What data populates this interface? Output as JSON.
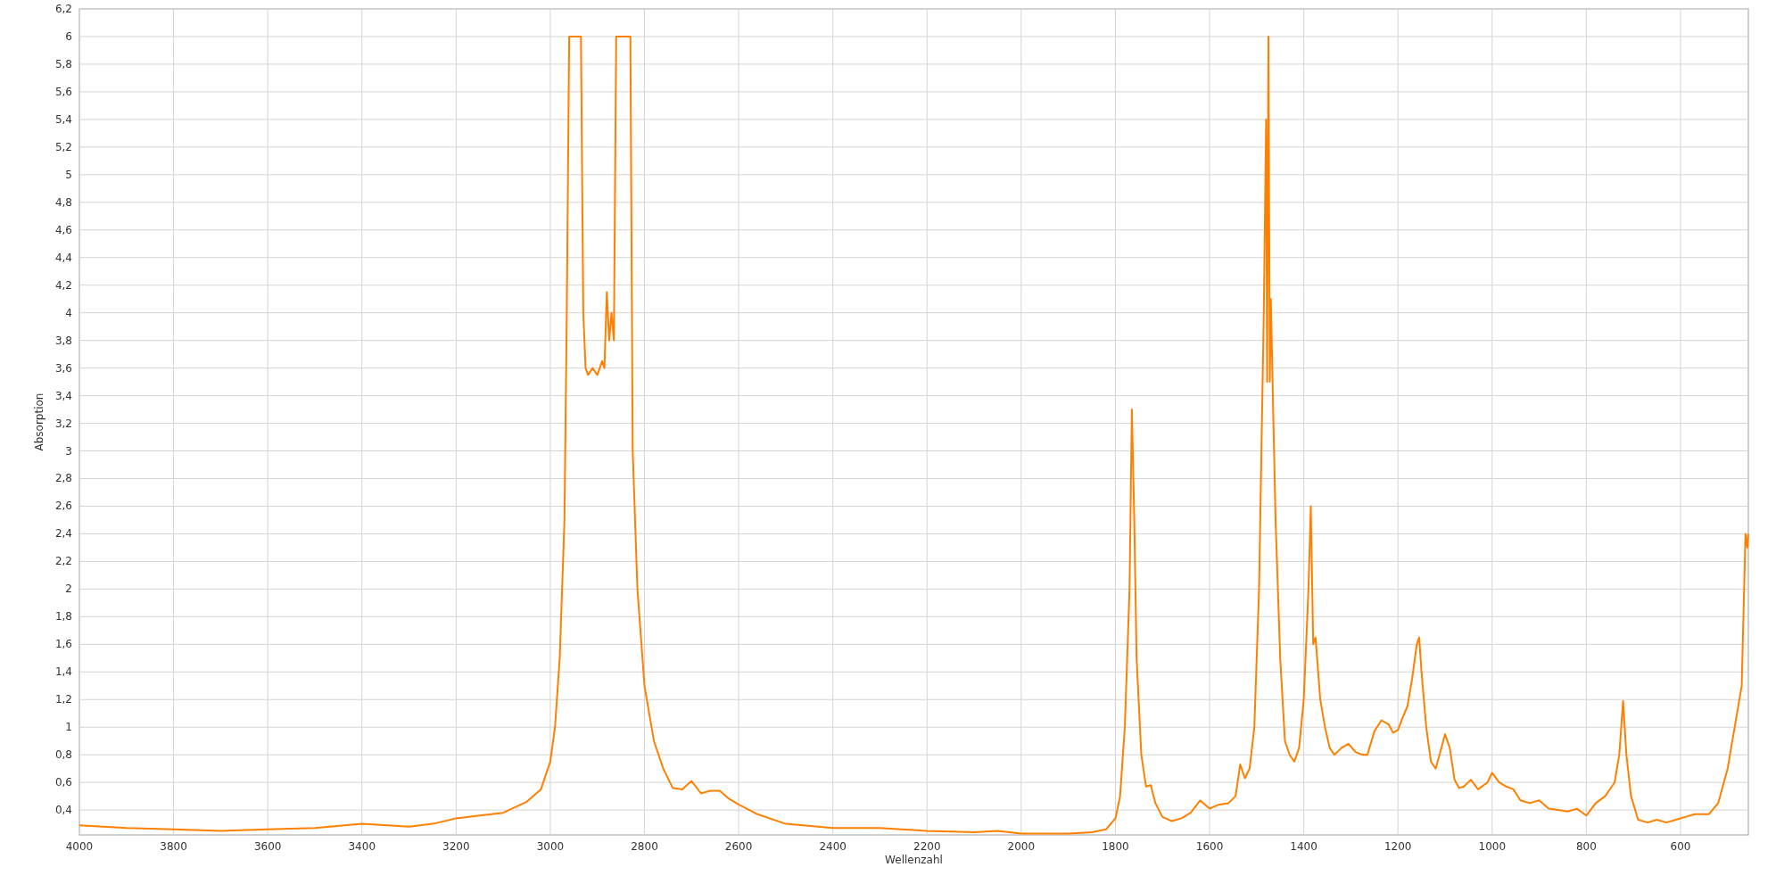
{
  "chart_data": {
    "type": "line",
    "grid": true,
    "xlabel": "Wellenzahl",
    "ylabel": "Absorption",
    "xlim": [
      4000,
      456
    ],
    "ylim": [
      0.22,
      6.2
    ],
    "xticks": [
      4000,
      3800,
      3600,
      3400,
      3200,
      3000,
      2800,
      2600,
      2400,
      2200,
      2000,
      1800,
      1600,
      1400,
      1200,
      1000,
      800,
      600
    ],
    "yticks": [
      {
        "value": 0.4,
        "label": "0,4"
      },
      {
        "value": 0.6,
        "label": "0,6"
      },
      {
        "value": 0.8,
        "label": "0,8"
      },
      {
        "value": 1,
        "label": "1"
      },
      {
        "value": 1.2,
        "label": "1,2"
      },
      {
        "value": 1.4,
        "label": "1,4"
      },
      {
        "value": 1.6,
        "label": "1,6"
      },
      {
        "value": 1.8,
        "label": "1,8"
      },
      {
        "value": 2,
        "label": "2"
      },
      {
        "value": 2.2,
        "label": "2,2"
      },
      {
        "value": 2.4,
        "label": "2,4"
      },
      {
        "value": 2.6,
        "label": "2,6"
      },
      {
        "value": 2.8,
        "label": "2,8"
      },
      {
        "value": 3,
        "label": "3"
      },
      {
        "value": 3.2,
        "label": "3,2"
      },
      {
        "value": 3.4,
        "label": "3,4"
      },
      {
        "value": 3.6,
        "label": "3,6"
      },
      {
        "value": 3.8,
        "label": "3,8"
      },
      {
        "value": 4,
        "label": "4"
      },
      {
        "value": 4.2,
        "label": "4,2"
      },
      {
        "value": 4.4,
        "label": "4,4"
      },
      {
        "value": 4.6,
        "label": "4,6"
      },
      {
        "value": 4.8,
        "label": "4,8"
      },
      {
        "value": 5,
        "label": "5"
      },
      {
        "value": 5.2,
        "label": "5,2"
      },
      {
        "value": 5.4,
        "label": "5,4"
      },
      {
        "value": 5.6,
        "label": "5,6"
      },
      {
        "value": 5.8,
        "label": "5,8"
      },
      {
        "value": 6,
        "label": "6"
      },
      {
        "value": 6.2,
        "label": "6,2"
      }
    ],
    "x": [
      4000,
      3900,
      3800,
      3700,
      3600,
      3500,
      3400,
      3300,
      3250,
      3200,
      3150,
      3100,
      3050,
      3020,
      3000,
      2990,
      2980,
      2970,
      2965,
      2960,
      2950,
      2940,
      2935,
      2930,
      2925,
      2920,
      2910,
      2900,
      2890,
      2885,
      2880,
      2875,
      2870,
      2865,
      2860,
      2850,
      2840,
      2830,
      2825,
      2815,
      2800,
      2780,
      2760,
      2740,
      2720,
      2700,
      2680,
      2660,
      2640,
      2620,
      2600,
      2560,
      2500,
      2400,
      2300,
      2200,
      2100,
      2050,
      2000,
      1900,
      1850,
      1820,
      1800,
      1790,
      1780,
      1770,
      1765,
      1760,
      1755,
      1745,
      1735,
      1725,
      1715,
      1700,
      1680,
      1660,
      1640,
      1620,
      1610,
      1600,
      1580,
      1560,
      1545,
      1535,
      1525,
      1515,
      1505,
      1495,
      1485,
      1480,
      1478,
      1475,
      1472,
      1470,
      1465,
      1460,
      1450,
      1440,
      1430,
      1420,
      1410,
      1400,
      1390,
      1385,
      1380,
      1375,
      1365,
      1355,
      1345,
      1335,
      1320,
      1305,
      1290,
      1275,
      1265,
      1250,
      1235,
      1220,
      1210,
      1200,
      1190,
      1180,
      1170,
      1160,
      1155,
      1150,
      1140,
      1130,
      1120,
      1110,
      1100,
      1090,
      1080,
      1070,
      1060,
      1045,
      1030,
      1010,
      1000,
      985,
      970,
      955,
      940,
      920,
      900,
      880,
      860,
      840,
      820,
      800,
      780,
      760,
      740,
      730,
      722,
      715,
      705,
      690,
      670,
      650,
      630,
      610,
      590,
      570,
      540,
      520,
      500,
      485,
      470,
      462,
      458,
      456
    ],
    "series": [
      {
        "color": "#ff8000",
        "values": [
          0.29,
          0.27,
          0.26,
          0.25,
          0.26,
          0.27,
          0.3,
          0.28,
          0.3,
          0.34,
          0.36,
          0.38,
          0.46,
          0.55,
          0.75,
          1.0,
          1.5,
          2.5,
          4.0,
          6.0,
          6.0,
          6.0,
          6.0,
          4.0,
          3.6,
          3.55,
          3.6,
          3.55,
          3.65,
          3.6,
          4.15,
          3.8,
          4.0,
          3.8,
          6.0,
          6.0,
          6.0,
          6.0,
          3.0,
          2.0,
          1.3,
          0.9,
          0.7,
          0.56,
          0.55,
          0.61,
          0.52,
          0.54,
          0.54,
          0.48,
          0.44,
          0.37,
          0.3,
          0.27,
          0.27,
          0.25,
          0.24,
          0.25,
          0.23,
          0.23,
          0.24,
          0.26,
          0.34,
          0.5,
          1.0,
          2.0,
          3.3,
          2.5,
          1.5,
          0.8,
          0.57,
          0.58,
          0.45,
          0.35,
          0.32,
          0.34,
          0.38,
          0.47,
          0.44,
          0.41,
          0.44,
          0.45,
          0.5,
          0.73,
          0.63,
          0.7,
          1.0,
          2.0,
          4.0,
          5.4,
          3.5,
          6.0,
          3.5,
          4.1,
          3.3,
          2.5,
          1.5,
          0.9,
          0.8,
          0.75,
          0.85,
          1.2,
          2.0,
          2.6,
          1.6,
          1.65,
          1.2,
          1.0,
          0.85,
          0.8,
          0.85,
          0.88,
          0.82,
          0.8,
          0.8,
          0.97,
          1.05,
          1.02,
          0.96,
          0.98,
          1.07,
          1.15,
          1.35,
          1.6,
          1.65,
          1.4,
          1.0,
          0.75,
          0.7,
          0.82,
          0.95,
          0.85,
          0.62,
          0.56,
          0.57,
          0.62,
          0.55,
          0.6,
          0.67,
          0.6,
          0.57,
          0.55,
          0.47,
          0.45,
          0.47,
          0.41,
          0.4,
          0.39,
          0.41,
          0.36,
          0.45,
          0.5,
          0.6,
          0.8,
          1.19,
          0.8,
          0.5,
          0.33,
          0.31,
          0.33,
          0.31,
          0.33,
          0.35,
          0.37,
          0.37,
          0.45,
          0.7,
          1.0,
          1.3,
          2.4,
          2.3,
          2.4
        ]
      }
    ]
  }
}
